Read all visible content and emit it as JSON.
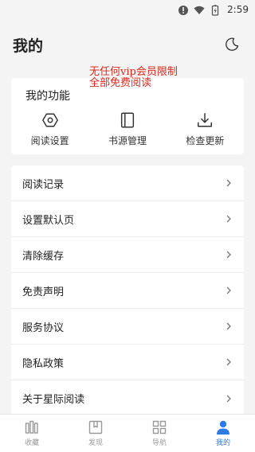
{
  "status_bar": {
    "time": "2:59"
  },
  "header": {
    "title": "我的"
  },
  "promo": {
    "line1": "无任何vip会员限制",
    "line2": "全部免费阅读"
  },
  "functions": {
    "title": "我的功能",
    "items": [
      {
        "label": "阅读设置",
        "icon": "hexagon-settings-icon"
      },
      {
        "label": "书源管理",
        "icon": "book-icon"
      },
      {
        "label": "检查更新",
        "icon": "download-icon"
      }
    ]
  },
  "settings": {
    "items": [
      {
        "label": "阅读记录"
      },
      {
        "label": "设置默认页"
      },
      {
        "label": "清除缓存"
      },
      {
        "label": "免责声明"
      },
      {
        "label": "服务协议"
      },
      {
        "label": "隐私政策"
      },
      {
        "label": "关于星际阅读"
      }
    ]
  },
  "bottom_nav": {
    "items": [
      {
        "label": "收藏",
        "icon": "bookshelf-icon"
      },
      {
        "label": "发现",
        "icon": "discover-icon"
      },
      {
        "label": "导航",
        "icon": "grid-icon"
      },
      {
        "label": "我的",
        "icon": "person-icon"
      }
    ],
    "active_color": "#2d7be5",
    "inactive_color": "#999999"
  }
}
